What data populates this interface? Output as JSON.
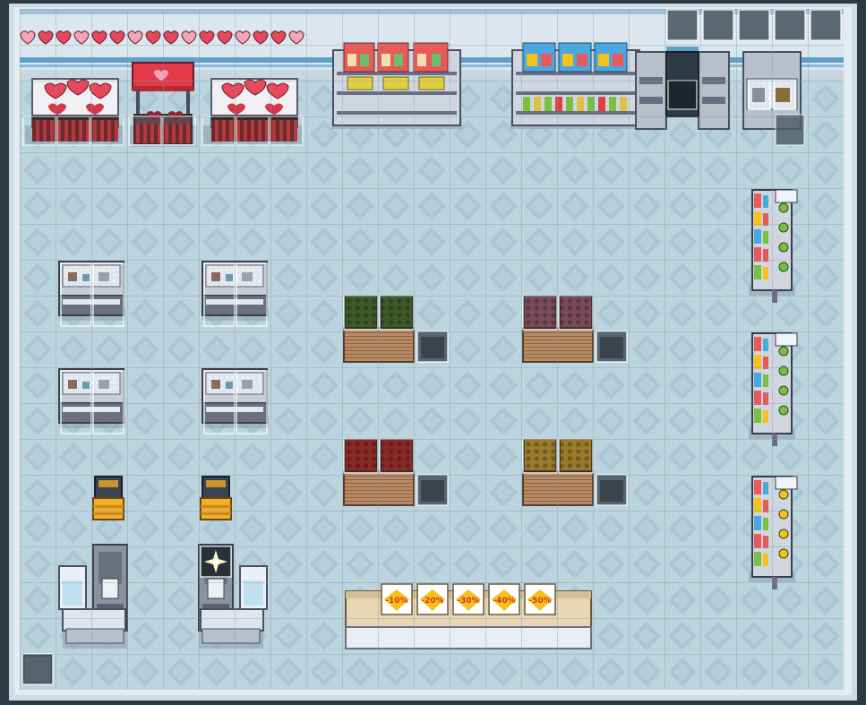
{
  "scene": {
    "colors": {
      "floor": "#bcd4de",
      "floor_diamond": "#a9c5d2",
      "grid": "#7e98a8",
      "wall": "#d8e4ec",
      "wall_stripe": "#5ea0c8",
      "outer_frame": "#2c3a44",
      "shadow": "#8ea4b0",
      "heart": "#e8485c",
      "heart_light": "#f4a6b8",
      "sale_tag": "#f6c21a",
      "sale_tag_text": "#d8342c"
    },
    "wall_hearts": {
      "count": 16
    },
    "sale_tags": [
      "-10%",
      "-20%",
      "-30%",
      "-40%",
      "-50%"
    ],
    "inventory_slots": {
      "count": 5
    },
    "produce_colors": {
      "green": "#3e5a2a",
      "purple": "#7a4a5a",
      "red": "#8a2a2a",
      "yellow": "#9a7a2a"
    }
  }
}
